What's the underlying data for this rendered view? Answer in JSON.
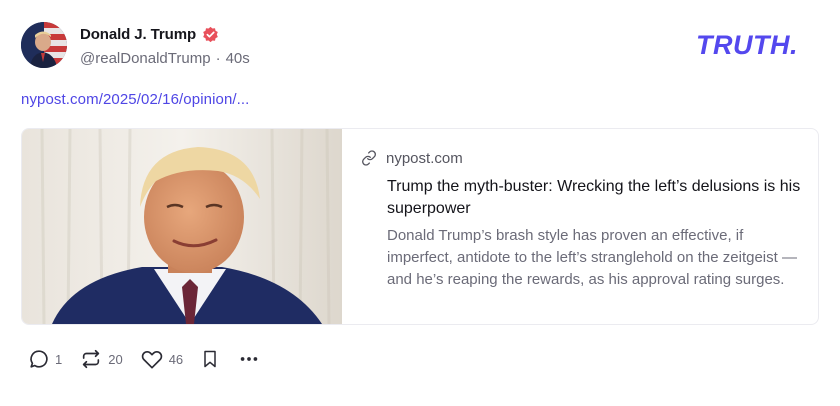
{
  "author": {
    "display_name": "Donald J. Trump",
    "handle": "@realDonaldTrump",
    "separator": "·",
    "time_ago": "40s",
    "verified": true
  },
  "brand": {
    "logo_text": "TRUTH.",
    "color": "#5448ee"
  },
  "post": {
    "link_text": "nypost.com/2025/02/16/opinion/..."
  },
  "link_card": {
    "domain": "nypost.com",
    "title": "Trump the myth-buster: Wrecking the left’s delusions is his superpower",
    "description": "Donald Trump’s brash style has proven an effective, if imperfect, antidote to the left’s stranglehold on the zeitgeist — and he’s reaping the rewards, as his approval rating surges."
  },
  "actions": {
    "reply_count": "1",
    "retruth_count": "20",
    "like_count": "46"
  },
  "colors": {
    "accent": "#5448ee",
    "link": "#4f46e5",
    "verified_badge": "#e8505b",
    "muted_text": "#6b6b78"
  }
}
